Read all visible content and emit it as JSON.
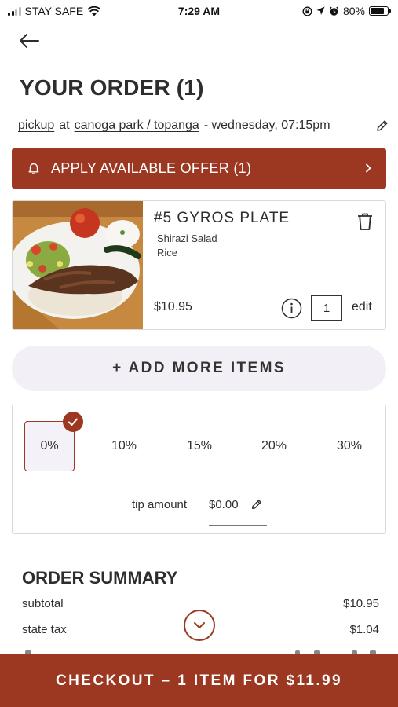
{
  "status_bar": {
    "carrier": "STAY SAFE",
    "time": "7:29 AM",
    "battery": "80%",
    "battery_level": 0.8
  },
  "header": {
    "title": "YOUR ORDER (1)"
  },
  "pickup": {
    "mode": "pickup",
    "at": "at",
    "location": "canoga park / topanga",
    "when": "- wednesday, 07:15pm"
  },
  "offer": {
    "label": "APPLY AVAILABLE OFFER (1)"
  },
  "cart_item": {
    "name": "#5 GYROS PLATE",
    "modifiers": [
      "Shirazi Salad",
      "Rice"
    ],
    "price": "$10.95",
    "quantity": "1",
    "edit_label": "edit"
  },
  "add_more": {
    "label": "+ ADD MORE ITEMS"
  },
  "tip": {
    "options": [
      "0%",
      "10%",
      "15%",
      "20%",
      "30%"
    ],
    "selected": "0%",
    "amount_label": "tip amount",
    "amount_value": "$0.00"
  },
  "summary": {
    "title": "ORDER SUMMARY",
    "rows": [
      {
        "label": "subtotal",
        "value": "$10.95"
      },
      {
        "label": "state tax",
        "value": "$1.04"
      }
    ]
  },
  "checkout": {
    "label": "CHECKOUT – 1 ITEM FOR $11.99"
  },
  "colors": {
    "accent": "#9c3822",
    "button_bg": "#f2f0f6",
    "text": "#2d2d2d"
  },
  "icons": [
    "signal-icon",
    "wifi-icon",
    "lock-rotation-icon",
    "location-icon",
    "alarm-icon",
    "battery-icon",
    "back-arrow-icon",
    "pencil-icon",
    "bell-icon",
    "chevron-right-icon",
    "trash-icon",
    "info-icon",
    "check-icon",
    "chevron-down-icon"
  ]
}
